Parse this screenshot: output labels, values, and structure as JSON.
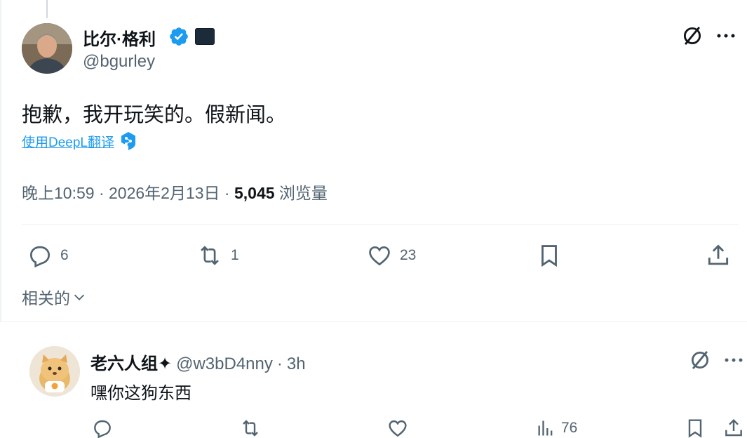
{
  "main_tweet": {
    "author_name": "比尔·格利",
    "author_handle": "@bgurley",
    "text": "抱歉，我开玩笑的。假新闻。",
    "translate_label": "使用DeepL翻译",
    "timestamp": "晚上10:59 · 2026年2月13日 · ",
    "views_count": "5,045",
    "views_label": " 浏览量",
    "actions": {
      "reply_count": "6",
      "retweet_count": "1",
      "like_count": "23"
    }
  },
  "related_toggle": "相关的",
  "reply": {
    "author_name": "老六人组✦",
    "author_handle": "@w3bD4nny",
    "separator": "·",
    "time": "3h",
    "text": "嘿你这狗东西",
    "views_count": "76"
  },
  "colors": {
    "verified": "#1d9bf0",
    "link": "#1d9bf0",
    "muted": "#536471",
    "text": "#0f1419"
  },
  "icons": [
    "no-sign-icon",
    "more-icon",
    "verified-icon",
    "reply-icon",
    "retweet-icon",
    "like-icon",
    "bookmark-icon",
    "share-icon",
    "views-icon",
    "chevron-down-icon",
    "deepl-icon"
  ]
}
